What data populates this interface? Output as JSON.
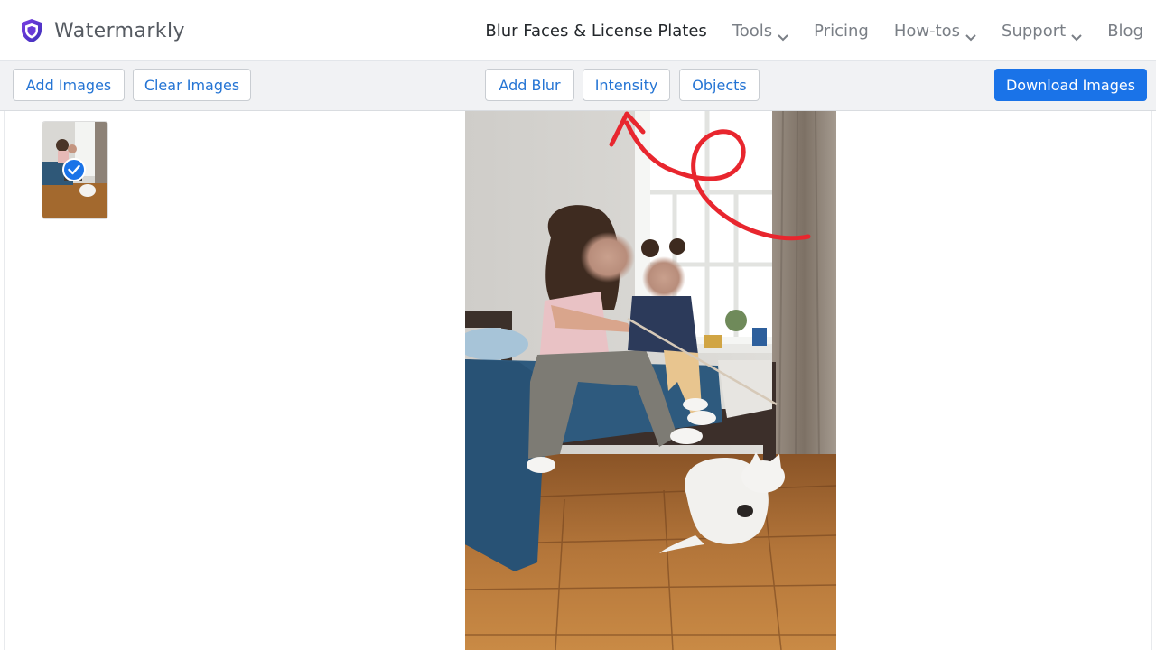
{
  "brand": {
    "name": "Watermarkly",
    "logo_icon": "shield-icon"
  },
  "nav": [
    {
      "label": "Blur Faces & License Plates",
      "active": true,
      "dropdown": false
    },
    {
      "label": "Tools",
      "dropdown": true
    },
    {
      "label": "Pricing",
      "dropdown": false
    },
    {
      "label": "How-tos",
      "dropdown": true
    },
    {
      "label": "Support",
      "dropdown": true
    },
    {
      "label": "Blog",
      "dropdown": false
    }
  ],
  "toolbar": {
    "add_images": "Add Images",
    "clear_images": "Clear Images",
    "add_blur": "Add Blur",
    "intensity": "Intensity",
    "objects": "Objects",
    "download_images": "Download Images"
  },
  "thumbnails": [
    {
      "selected": true,
      "status_icon": "checkmark-icon"
    }
  ],
  "annotation": {
    "icon": "curly-arrow-icon",
    "color": "#e8262e",
    "points_to": "Intensity"
  },
  "colors": {
    "accent": "#1a73e8",
    "link": "#2474d4",
    "annotation": "#e8262e"
  }
}
